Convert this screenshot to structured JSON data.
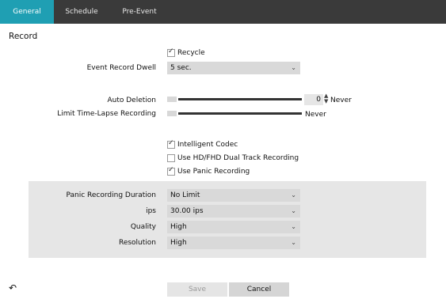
{
  "tabs": [
    {
      "label": "General",
      "active": true
    },
    {
      "label": "Schedule",
      "active": false
    },
    {
      "label": "Pre-Event",
      "active": false
    }
  ],
  "section_title": "Record",
  "recycle": {
    "label": "Recycle",
    "checked": true
  },
  "event_record_dwell": {
    "label": "Event Record Dwell",
    "value": "5 sec."
  },
  "auto_deletion": {
    "label": "Auto Deletion",
    "value": "0",
    "suffix": "Never",
    "level": 0
  },
  "limit_timelapse": {
    "label": "Limit Time-Lapse Recording",
    "suffix": "Never",
    "level": 0
  },
  "options": [
    {
      "label": "Intelligent Codec",
      "checked": true
    },
    {
      "label": "Use HD/FHD Dual Track Recording",
      "checked": false
    },
    {
      "label": "Use Panic Recording",
      "checked": true
    }
  ],
  "panic": {
    "duration": {
      "label": "Panic Recording Duration",
      "value": "No Limit"
    },
    "ips": {
      "label": "ips",
      "value": "30.00 ips"
    },
    "quality": {
      "label": "Quality",
      "value": "High"
    },
    "resolution": {
      "label": "Resolution",
      "value": "High"
    }
  },
  "buttons": {
    "save": "Save",
    "cancel": "Cancel"
  },
  "icons": {
    "back": "back-arrow-icon",
    "dropdown": "chevron-down-icon"
  },
  "colors": {
    "tab_bar": "#3a3a3a",
    "active_tab": "#1f9fb3",
    "control": "#d9d9d9",
    "panel": "#e6e6e6"
  }
}
